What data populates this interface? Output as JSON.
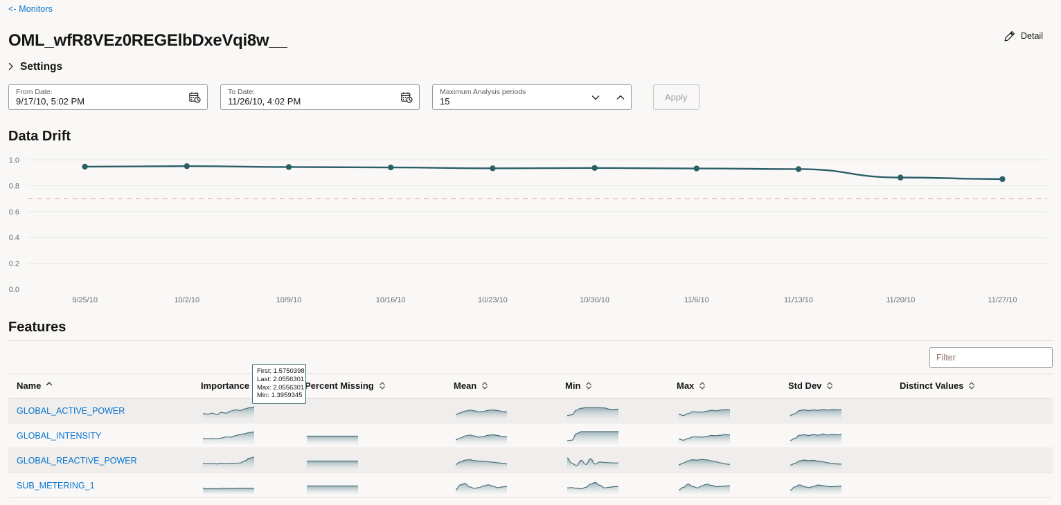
{
  "breadcrumb": {
    "label": "<- Monitors"
  },
  "page": {
    "title": "OML_wfR8VEz0REGElbDxeVqi8w__"
  },
  "detail": {
    "label": "Detail",
    "icon": "pencil-icon"
  },
  "settings": {
    "label": "Settings",
    "chevron": "chevron-right-icon",
    "expanded": false
  },
  "controls": {
    "from_date": {
      "label": "From Date:",
      "value": "9/17/10, 5:02 PM",
      "icon": "calendar-clock-icon"
    },
    "to_date": {
      "label": "To Date:",
      "value": "11/26/10, 4:02 PM",
      "icon": "calendar-clock-icon"
    },
    "periods": {
      "label": "Maximum Analysis periods",
      "value": "15",
      "down_icon": "chevron-down-icon",
      "up_icon": "chevron-up-icon"
    },
    "apply": {
      "label": "Apply",
      "disabled": true
    }
  },
  "data_drift": {
    "title": "Data Drift"
  },
  "chart_data": {
    "type": "line",
    "title": "Data Drift",
    "xlabel": "",
    "ylabel": "",
    "ylim": [
      0.0,
      1.0
    ],
    "yticks": [
      "0.0",
      "0.2",
      "0.4",
      "0.6",
      "0.8",
      "1.0"
    ],
    "grid": true,
    "legend": "none",
    "line_color": "#2b5f66",
    "marker_color": "#2b5f66",
    "threshold": {
      "value": 0.7,
      "color": "#f4bdbd",
      "style": "dashed",
      "label": ""
    },
    "x": [
      "9/25/10",
      "10/2/10",
      "10/9/10",
      "10/16/10",
      "10/23/10",
      "10/30/10",
      "11/6/10",
      "11/13/10",
      "11/20/10",
      "11/27/10"
    ],
    "xticks": [
      "9/25/10",
      "10/2/10",
      "10/9/10",
      "10/16/10",
      "10/23/10",
      "10/30/10",
      "11/6/10",
      "11/13/10",
      "11/20/10",
      "11/27/10"
    ],
    "series": [
      {
        "name": "Drift",
        "values": [
          0.947,
          0.951,
          0.944,
          0.941,
          0.934,
          0.937,
          0.933,
          0.928,
          0.863,
          0.851
        ]
      }
    ]
  },
  "features": {
    "title": "Features",
    "filter": {
      "placeholder": "Filter",
      "value": ""
    },
    "columns": [
      {
        "label": "Name",
        "sort": "asc"
      },
      {
        "label": "Importance",
        "sort": "none"
      },
      {
        "label": "Percent Missing",
        "sort": "both"
      },
      {
        "label": "Mean",
        "sort": "both"
      },
      {
        "label": "Min",
        "sort": "both"
      },
      {
        "label": "Max",
        "sort": "both"
      },
      {
        "label": "Std Dev",
        "sort": "both"
      },
      {
        "label": "Distinct Values",
        "sort": "both"
      }
    ],
    "rows": [
      {
        "name": "GLOBAL_ACTIVE_POWER",
        "importance": [
          0.3,
          0.26,
          0.34,
          0.22,
          0.4,
          0.34,
          0.52,
          0.62,
          0.58,
          0.7,
          0.8,
          0.86
        ],
        "percent_missing": null,
        "mean": [
          0.22,
          0.36,
          0.52,
          0.6,
          0.54,
          0.44,
          0.48,
          0.58,
          0.62,
          0.56,
          0.48,
          0.44
        ],
        "min": [
          0.14,
          0.2,
          0.6,
          0.76,
          0.8,
          0.8,
          0.8,
          0.8,
          0.78,
          0.68,
          0.66,
          0.68
        ],
        "max": [
          0.26,
          0.14,
          0.3,
          0.46,
          0.44,
          0.42,
          0.5,
          0.58,
          0.54,
          0.6,
          0.64,
          0.62
        ],
        "std_dev": [
          0.14,
          0.3,
          0.56,
          0.62,
          0.56,
          0.62,
          0.58,
          0.66,
          0.6,
          0.66,
          0.62,
          0.64
        ],
        "distinct_values": null
      },
      {
        "name": "GLOBAL_INTENSITY",
        "importance": [
          0.3,
          0.28,
          0.3,
          0.28,
          0.34,
          0.44,
          0.42,
          0.54,
          0.64,
          0.72,
          0.82,
          0.86
        ],
        "percent_missing": [
          0.5,
          0.5,
          0.5,
          0.5,
          0.5,
          0.5,
          0.5,
          0.5,
          0.5,
          0.5,
          0.5,
          0.5
        ],
        "mean": [
          0.2,
          0.34,
          0.52,
          0.6,
          0.52,
          0.42,
          0.48,
          0.58,
          0.62,
          0.56,
          0.48,
          0.44
        ],
        "min": [
          0.12,
          0.16,
          0.72,
          0.88,
          0.88,
          0.88,
          0.88,
          0.88,
          0.88,
          0.88,
          0.88,
          0.88
        ],
        "max": [
          0.26,
          0.16,
          0.3,
          0.44,
          0.44,
          0.42,
          0.48,
          0.56,
          0.54,
          0.58,
          0.64,
          0.62
        ],
        "std_dev": [
          0.14,
          0.32,
          0.58,
          0.62,
          0.56,
          0.64,
          0.58,
          0.68,
          0.6,
          0.66,
          0.62,
          0.64
        ],
        "distinct_values": null
      },
      {
        "name": "GLOBAL_REACTIVE_POWER",
        "importance": [
          0.3,
          0.28,
          0.28,
          0.26,
          0.3,
          0.28,
          0.3,
          0.3,
          0.34,
          0.52,
          0.74,
          0.84
        ],
        "percent_missing": [
          0.5,
          0.5,
          0.5,
          0.5,
          0.5,
          0.5,
          0.5,
          0.5,
          0.5,
          0.5,
          0.5,
          0.5
        ],
        "mean": [
          0.22,
          0.42,
          0.58,
          0.62,
          0.54,
          0.5,
          0.48,
          0.44,
          0.4,
          0.36,
          0.3,
          0.26
        ],
        "min": [
          0.76,
          0.3,
          0.12,
          0.56,
          0.22,
          0.7,
          0.24,
          0.42,
          0.38,
          0.36,
          0.34,
          0.34
        ],
        "max": [
          0.18,
          0.34,
          0.52,
          0.62,
          0.58,
          0.64,
          0.6,
          0.52,
          0.44,
          0.34,
          0.26,
          0.22
        ],
        "std_dev": [
          0.16,
          0.3,
          0.52,
          0.58,
          0.54,
          0.56,
          0.5,
          0.44,
          0.36,
          0.3,
          0.26,
          0.24
        ],
        "distinct_values": null
      },
      {
        "name": "SUB_METERING_1",
        "importance": [
          0.3,
          0.26,
          0.28,
          0.26,
          0.3,
          0.28,
          0.3,
          0.28,
          0.32,
          0.3,
          0.3,
          0.3
        ],
        "percent_missing": [
          0.5,
          0.5,
          0.5,
          0.5,
          0.5,
          0.5,
          0.5,
          0.5,
          0.5,
          0.5,
          0.5,
          0.5
        ],
        "mean": [
          0.18,
          0.6,
          0.72,
          0.42,
          0.3,
          0.36,
          0.52,
          0.6,
          0.48,
          0.36,
          0.42,
          0.46
        ],
        "min": [
          0.34,
          0.36,
          0.3,
          0.26,
          0.38,
          0.66,
          0.8,
          0.56,
          0.34,
          0.38,
          0.44,
          0.46
        ],
        "max": [
          0.16,
          0.38,
          0.66,
          0.46,
          0.34,
          0.52,
          0.66,
          0.56,
          0.44,
          0.46,
          0.5,
          0.52
        ],
        "std_dev": [
          0.14,
          0.42,
          0.6,
          0.44,
          0.36,
          0.46,
          0.58,
          0.54,
          0.46,
          0.44,
          0.48,
          0.5
        ],
        "distinct_values": null
      }
    ]
  },
  "tooltip": {
    "first": "First: 1.5750398",
    "last": "Last: 2.0556301",
    "max": "Max: 2.0556301",
    "min": "Min: 1.3959345"
  }
}
